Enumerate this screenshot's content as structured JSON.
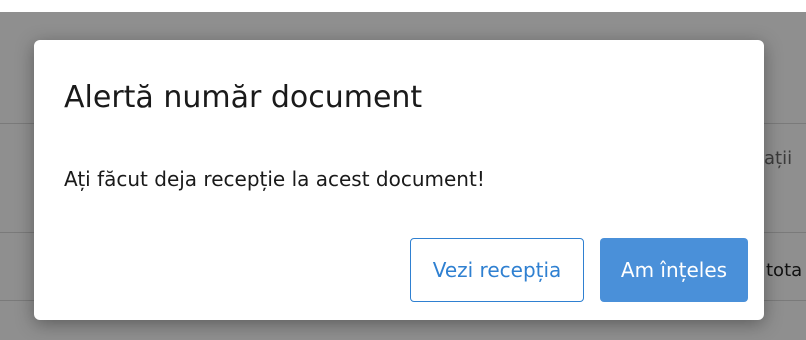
{
  "background": {
    "partial_label_1": "ații",
    "partial_label_2": "tota"
  },
  "dialog": {
    "title": "Alertă număr document",
    "message": "Ați făcut deja recepție la acest document!",
    "secondary_button_label": "Vezi recepția",
    "primary_button_label": "Am înțeles"
  },
  "colors": {
    "accent": "#4a90d9",
    "outline": "#2f80d1",
    "backdrop": "#8f8f8f"
  }
}
